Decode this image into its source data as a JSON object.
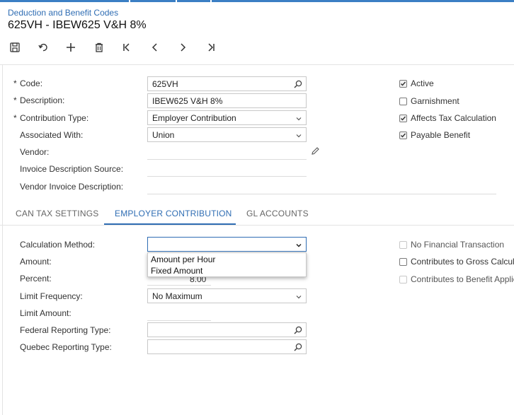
{
  "breadcrumb": "Deduction and Benefit Codes",
  "title": "625VH - IBEW625 V&H 8%",
  "toolbar": {
    "buttons": [
      "save-icon",
      "undo-icon",
      "add-icon",
      "delete-icon",
      "first-icon",
      "previous-icon",
      "next-icon",
      "last-icon"
    ]
  },
  "form": {
    "required_mark": "*",
    "code_label": "Code:",
    "code_value": "625VH",
    "description_label": "Description:",
    "description_value": "IBEW625 V&H 8%",
    "contribution_type_label": "Contribution Type:",
    "contribution_type_value": "Employer Contribution",
    "associated_with_label": "Associated With:",
    "associated_with_value": "Union",
    "vendor_label": "Vendor:",
    "invoice_desc_source_label": "Invoice Description Source:",
    "vendor_invoice_desc_label": "Vendor Invoice Description:"
  },
  "checks": {
    "active": {
      "label": "Active",
      "checked": true
    },
    "garnishment": {
      "label": "Garnishment",
      "checked": false
    },
    "affects_tax": {
      "label": "Affects Tax Calculation",
      "checked": true
    },
    "payable_benefit": {
      "label": "Payable Benefit",
      "checked": true
    }
  },
  "tabs": [
    "CAN TAX SETTINGS",
    "EMPLOYER CONTRIBUTION",
    "GL ACCOUNTS"
  ],
  "active_tab": "EMPLOYER CONTRIBUTION",
  "employer": {
    "calc_method_label": "Calculation Method:",
    "calc_method_value": "",
    "calc_method_options": [
      "Amount per Hour",
      "Fixed Amount"
    ],
    "amount_label": "Amount:",
    "percent_label": "Percent:",
    "percent_value": "8.00",
    "limit_frequency_label": "Limit Frequency:",
    "limit_frequency_value": "No Maximum",
    "limit_amount_label": "Limit Amount:",
    "federal_reporting_label": "Federal Reporting Type:",
    "quebec_reporting_label": "Quebec Reporting Type:"
  },
  "employer_checks": {
    "no_financial": {
      "label": "No Financial Transaction",
      "checked": false
    },
    "gross_calc": {
      "label": "Contributes to Gross Calcula",
      "checked": false
    },
    "benefit_applic": {
      "label": "Contributes to Benefit Applic",
      "checked": false
    }
  },
  "colors": {
    "accent": "#2f6db3",
    "top_strip": "#3b7fc4"
  }
}
